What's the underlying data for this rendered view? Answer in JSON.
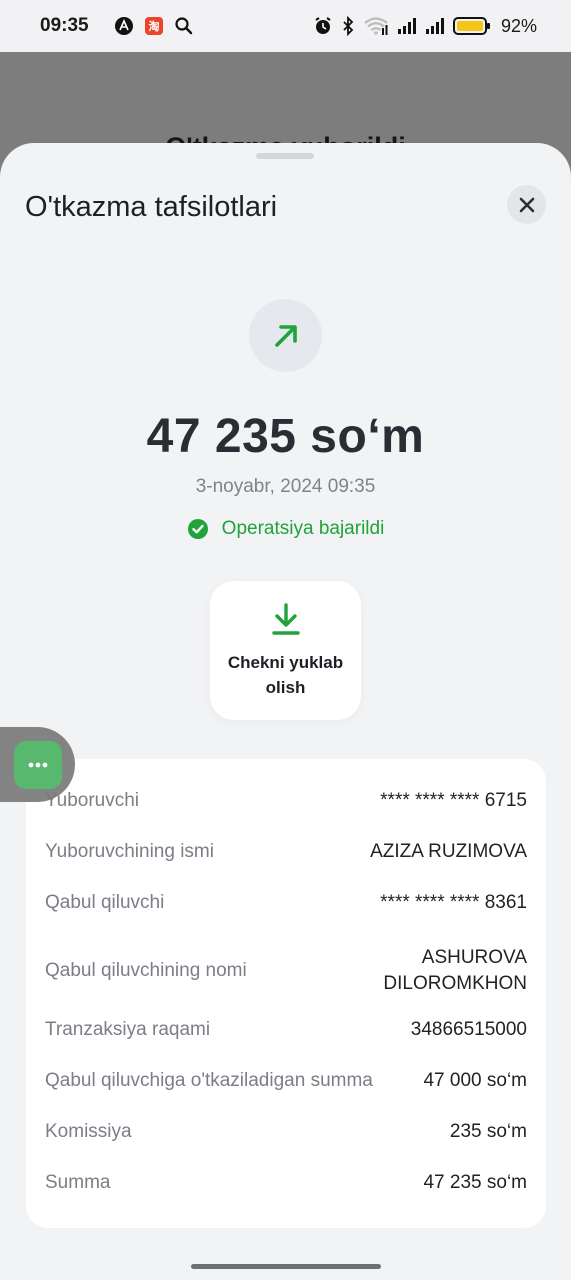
{
  "status_bar": {
    "time": "09:35",
    "battery_percent": "92%",
    "left_icons": [
      "app-a-icon",
      "taobao-app-icon",
      "search-icon"
    ],
    "right_icons": [
      "alarm-icon",
      "bluetooth-icon",
      "wifi-icon",
      "signal-icon",
      "signal-icon",
      "battery-icon"
    ]
  },
  "background_page": {
    "title": "O'tkazma yuborildi"
  },
  "sheet": {
    "title": "O'tkazma tafsilotlari",
    "close_icon": "close-icon",
    "direction_icon": "outgoing-arrow-icon",
    "amount": "47 235 so‘m",
    "datetime": "3-noyabr, 2024 09:35",
    "status": "Operatsiya bajarildi",
    "download_label": "Chekni yuklab olish",
    "colors": {
      "success": "#1fa33a",
      "accent": "#1fa33a"
    }
  },
  "details": [
    {
      "label": "Yuboruvchi",
      "value": "**** **** **** 6715"
    },
    {
      "label": "Yuboruvchining ismi",
      "value": "AZIZA RUZIMOVA"
    },
    {
      "label": "Qabul qiluvchi",
      "value": "**** **** **** 8361"
    },
    {
      "label": "Qabul qiluvchining nomi",
      "value": "ASHUROVA DILOROMKHON"
    },
    {
      "label": "Tranzaksiya raqami",
      "value": "34866515000"
    },
    {
      "label": "Qabul qiluvchiga o'tkaziladigan summa",
      "value": "47 000 so‘m"
    },
    {
      "label": "Komissiya",
      "value": "235 so‘m"
    },
    {
      "label": "Summa",
      "value": "47 235 so‘m"
    }
  ]
}
